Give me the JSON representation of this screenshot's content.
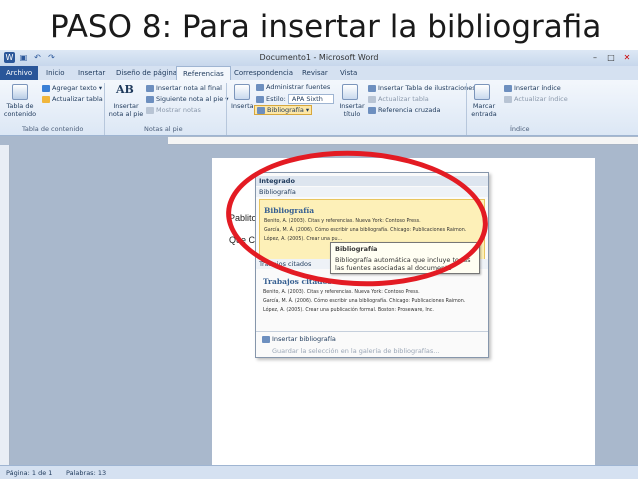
{
  "slide": {
    "title": "PASO 8: Para insertar la bibliografia"
  },
  "window": {
    "title": "Documento1 - Microsoft Word",
    "qat_icons": [
      "word-icon",
      "save-icon",
      "undo-icon",
      "redo-icon"
    ],
    "controls": {
      "minimize": "–",
      "maximize": "□",
      "close": "✕"
    }
  },
  "tabs": [
    "Archivo",
    "Inicio",
    "Insertar",
    "Diseño de página",
    "Referencias",
    "Correspondencia",
    "Revisar",
    "Vista"
  ],
  "active_tab": "Referencias",
  "ribbon": {
    "toc": {
      "button": "Tabla de contenido",
      "add_text": "Agregar texto",
      "update": "Actualizar tabla",
      "group": "Tabla de contenido"
    },
    "footnotes": {
      "insert": "Insertar nota al pie",
      "ab_icon": "AB",
      "endnote": "Insertar nota al final",
      "next": "Siguiente nota al pie",
      "show": "Mostrar notas",
      "group": "Notas al pie"
    },
    "citations": {
      "insert_cite": "Insertar cita",
      "manage": "Administrar fuentes",
      "style_label": "Estilo:",
      "style_value": "APA Sixth",
      "bibliography": "Bibliografía"
    },
    "captions": {
      "insert_title": "Insertar título",
      "insert_table": "Insertar Tabla de ilustraciones",
      "update": "Actualizar tabla",
      "cross_ref": "Referencia cruzada"
    },
    "index": {
      "mark": "Marcar entrada",
      "insert": "Insertar índice",
      "update": "Actualizar índice",
      "group": "Índice"
    }
  },
  "document": {
    "line1": "Pablito c",
    "line2": "Que Cla"
  },
  "dropdown": {
    "header": "Integrado",
    "items": [
      {
        "label": "Bibliografía",
        "heading": "Bibliografía",
        "lines": [
          "Benito, A. (2003). Citas y referencias. Nueva York: Contoso Press.",
          "García, M. Á. (2006). Cómo escribir una bibliografía. Chicago: Publicaciones Raimon.",
          "López, A. (2005). Crear una pu..."
        ]
      },
      {
        "label": "Trabajos citados",
        "heading": "Trabajos citados",
        "lines": [
          "Benito, A. (2003). Citas y referencias. Nueva York: Contoso Press.",
          "García, M. Á. (2006). Cómo escribir una bibliografía. Chicago: Publicaciones Raimon.",
          "López, A. (2005). Crear una publicación formal. Boston: Proseware, Inc."
        ]
      }
    ],
    "insert": "Insertar bibliografía",
    "save": "Guardar la selección en la galería de bibliografías..."
  },
  "tooltip": {
    "title": "Bibliografía",
    "body": "Bibliografía automática que incluye todas las fuentes asociadas al documento"
  },
  "status": {
    "page": "Página: 1 de 1",
    "words": "Palabras: 13"
  },
  "colors": {
    "annotation": "#e31b23",
    "office_blue": "#2a5699",
    "highlight": "#fdf0b8"
  }
}
